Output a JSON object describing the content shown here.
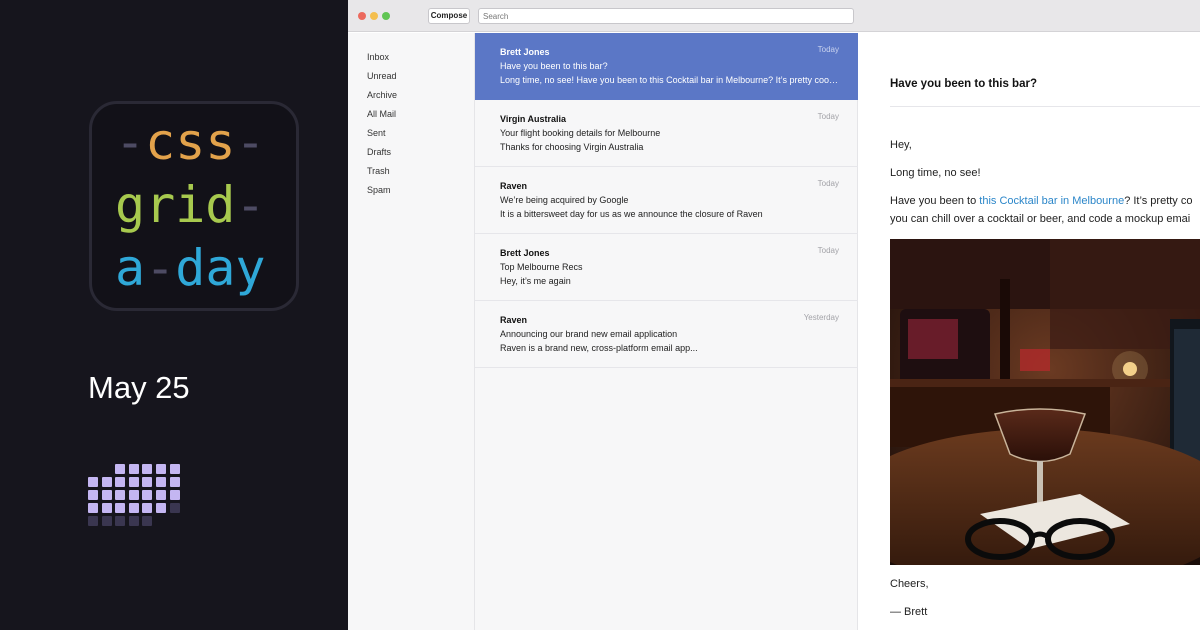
{
  "brand": {
    "logo_lines": [
      {
        "pre": "-",
        "word": "css",
        "post": "-"
      },
      {
        "pre": "",
        "word": "grid",
        "post": "-"
      },
      {
        "pre": "",
        "word": "a",
        "mid": "-",
        "word2": "day",
        "post": ""
      }
    ],
    "date": "May 25",
    "colors": {
      "css": "#e2a24b",
      "grid": "#a7c94e",
      "day": "#2fa8d8",
      "dash": "#4d4b63"
    },
    "calendar_cells": [
      {
        "row": 0,
        "col": 2,
        "state": "done"
      },
      {
        "row": 0,
        "col": 3,
        "state": "done"
      },
      {
        "row": 0,
        "col": 4,
        "state": "done"
      },
      {
        "row": 0,
        "col": 5,
        "state": "done"
      },
      {
        "row": 0,
        "col": 6,
        "state": "done"
      },
      {
        "row": 1,
        "col": 0,
        "state": "done"
      },
      {
        "row": 1,
        "col": 1,
        "state": "done"
      },
      {
        "row": 1,
        "col": 2,
        "state": "done"
      },
      {
        "row": 1,
        "col": 3,
        "state": "done"
      },
      {
        "row": 1,
        "col": 4,
        "state": "done"
      },
      {
        "row": 1,
        "col": 5,
        "state": "done"
      },
      {
        "row": 1,
        "col": 6,
        "state": "done"
      },
      {
        "row": 2,
        "col": 0,
        "state": "done"
      },
      {
        "row": 2,
        "col": 1,
        "state": "done"
      },
      {
        "row": 2,
        "col": 2,
        "state": "done"
      },
      {
        "row": 2,
        "col": 3,
        "state": "done"
      },
      {
        "row": 2,
        "col": 4,
        "state": "done"
      },
      {
        "row": 2,
        "col": 5,
        "state": "done"
      },
      {
        "row": 2,
        "col": 6,
        "state": "done"
      },
      {
        "row": 3,
        "col": 0,
        "state": "done"
      },
      {
        "row": 3,
        "col": 1,
        "state": "done"
      },
      {
        "row": 3,
        "col": 2,
        "state": "done"
      },
      {
        "row": 3,
        "col": 3,
        "state": "done"
      },
      {
        "row": 3,
        "col": 4,
        "state": "done"
      },
      {
        "row": 3,
        "col": 5,
        "state": "done"
      },
      {
        "row": 3,
        "col": 6,
        "state": "todo"
      },
      {
        "row": 4,
        "col": 0,
        "state": "todo"
      },
      {
        "row": 4,
        "col": 1,
        "state": "todo"
      },
      {
        "row": 4,
        "col": 2,
        "state": "todo"
      },
      {
        "row": 4,
        "col": 3,
        "state": "todo"
      },
      {
        "row": 4,
        "col": 4,
        "state": "todo"
      }
    ],
    "cell_colors": {
      "done": "#c4b6f2",
      "todo": "#3a3650"
    }
  },
  "window": {
    "traffic_lights": [
      "#ec6a5e",
      "#f4bf4f",
      "#61c554"
    ],
    "compose_label": "Compose",
    "search_placeholder": "Search"
  },
  "sidebar": {
    "items": [
      {
        "label": "Inbox"
      },
      {
        "label": "Unread"
      },
      {
        "label": "Archive"
      },
      {
        "label": "All Mail"
      },
      {
        "label": "Sent"
      },
      {
        "label": "Drafts"
      },
      {
        "label": "Trash"
      },
      {
        "label": "Spam"
      }
    ]
  },
  "messages": [
    {
      "from": "Brett Jones",
      "subject": "Have you been to this bar?",
      "preview": "Long time, no see! Have you been to this Cocktail bar in Melbourne? It’s pretty cool — you can chill over a cocktail or beer",
      "when": "Today",
      "selected": true
    },
    {
      "from": "Virgin Australia",
      "subject": "Your flight booking details for Melbourne",
      "preview": "Thanks for choosing Virgin Australia",
      "when": "Today",
      "selected": false
    },
    {
      "from": "Raven",
      "subject": "We’re being acquired by Google",
      "preview": "It is a bittersweet day for us as we announce the closure of Raven",
      "when": "Today",
      "selected": false
    },
    {
      "from": "Brett Jones",
      "subject": "Top Melbourne Recs",
      "preview": "Hey, it’s me again",
      "when": "Today",
      "selected": false
    },
    {
      "from": "Raven",
      "subject": "Announcing our brand new email application",
      "preview": "Raven is a brand new, cross-platform email app...",
      "when": "Yesterday",
      "selected": false
    }
  ],
  "reader": {
    "subject": "Have you been to this bar?",
    "greeting": "Hey,",
    "line1": "Long time, no see!",
    "line2_before": "Have you been to ",
    "line2_link": "this Cocktail bar in Melbourne",
    "line2_after": "? It’s pretty co",
    "line3": "you can chill over a cocktail or beer, and code a mockup emai",
    "signoff": "Cheers,",
    "signature": "— Brett",
    "link_color": "#2b86c9"
  },
  "accent": "#5b77c6"
}
